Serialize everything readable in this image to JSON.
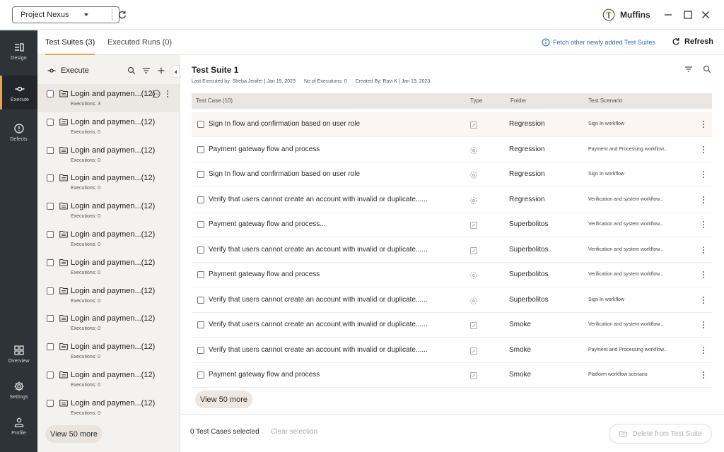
{
  "window": {
    "project_name": "Project Nexus",
    "user_name": "Muffins"
  },
  "rail": {
    "items": [
      {
        "label": "Design",
        "icon": "design-icon"
      },
      {
        "label": "Execute",
        "icon": "execute-icon",
        "active": true
      },
      {
        "label": "Defects",
        "icon": "defects-icon"
      },
      {
        "label": "Overview",
        "icon": "overview-icon"
      },
      {
        "label": "Settings",
        "icon": "settings-icon"
      },
      {
        "label": "Profile",
        "icon": "profile-icon"
      }
    ]
  },
  "tabs": [
    {
      "label": "Test Suites (3)",
      "active": true
    },
    {
      "label": "Executed Runs (0)",
      "active": false
    }
  ],
  "toolbar": {
    "fetch_label": "Fetch other newly added Test Suites",
    "refresh_label": "Refresh"
  },
  "suites": {
    "header": "Execute",
    "items": [
      {
        "name": "Login and paymen...(12)",
        "executions": "Executions: 3",
        "active": true
      },
      {
        "name": "Login and paymen...(12)",
        "executions": "Executions: 0"
      },
      {
        "name": "Login and paymen...(12)",
        "executions": "Executions: 0"
      },
      {
        "name": "Login and paymen...(12)",
        "executions": "Executions: 0"
      },
      {
        "name": "Login and paymen...(12)",
        "executions": "Executions: 0"
      },
      {
        "name": "Login and paymen...(12)",
        "executions": "Executions: 0"
      },
      {
        "name": "Login and paymen...(12)",
        "executions": "Executions: 0"
      },
      {
        "name": "Login and paymen...(12)",
        "executions": "Executions: 0"
      },
      {
        "name": "Login and paymen...(12)",
        "executions": "Executions: 0"
      },
      {
        "name": "Login and paymen...(12)",
        "executions": "Executions: 0"
      },
      {
        "name": "Login and paymen...(12)",
        "executions": "Executions: 0"
      },
      {
        "name": "Login and paymen...(12)",
        "executions": "Executions: 0"
      }
    ],
    "view_more": "View 50 more"
  },
  "main": {
    "title": "Test Suite 1",
    "last_executed": "Last Executed by:  Sheba Jenifer | Jan 19, 2023",
    "executions": "No of Executions: 0",
    "created_by": "Created By: Ravi K | Jan 19, 2023",
    "columns": [
      "Test Case (10)",
      "Type",
      "Folder",
      "Test Scenario"
    ],
    "rows": [
      {
        "test_case": "Sign In flow and confirmation based on user role",
        "type": "manual",
        "folder": "Regression",
        "scenario": "Sign In workflow"
      },
      {
        "test_case": "Payment gateway flow and process",
        "type": "automated",
        "folder": "Regression",
        "scenario": "Payment and Processing workflow..."
      },
      {
        "test_case": "Sign In flow and confirmation based on user role",
        "type": "automated",
        "folder": "Regression",
        "scenario": "Sign In workflow"
      },
      {
        "test_case": "Verify that users cannot create an account with invalid or duplicate......",
        "type": "automated",
        "folder": "Regression",
        "scenario": "Verification and system workflow..."
      },
      {
        "test_case": "Payment gateway flow and process...",
        "type": "manual",
        "folder": "Superbolitos",
        "scenario": "Verification and system workflow..."
      },
      {
        "test_case": "Verify that users cannot create an account with invalid or duplicate......",
        "type": "manual",
        "folder": "Superbolitos",
        "scenario": "Verification and system workflow..."
      },
      {
        "test_case": "Payment gateway flow and process",
        "type": "automated",
        "folder": "Superbolitos",
        "scenario": "Verification and system workflow..."
      },
      {
        "test_case": "Verify that users cannot create an account with invalid or duplicate......",
        "type": "automated",
        "folder": "Superbolitos",
        "scenario": "Sign In workflow"
      },
      {
        "test_case": "Verify that users cannot create an account with invalid or duplicate......",
        "type": "manual",
        "folder": "Smoke",
        "scenario": "Verification and system workflow..."
      },
      {
        "test_case": "Verify that users cannot create an account with invalid or duplicate......",
        "type": "manual",
        "folder": "Smoke",
        "scenario": "Payment and Processing workflow..."
      },
      {
        "test_case": "Payment gateway flow and process",
        "type": "manual",
        "folder": "Smoke",
        "scenario": "Platform workflow scenario"
      }
    ],
    "view_more": "View 50 more"
  },
  "footer": {
    "selected": "0 Test Cases selected",
    "clear": "Clear selection",
    "delete": "Delete from Test Suite"
  },
  "colors": {
    "rail_bg": "#2e3337",
    "accent": "#e8a44d",
    "link": "#2d6db5"
  }
}
